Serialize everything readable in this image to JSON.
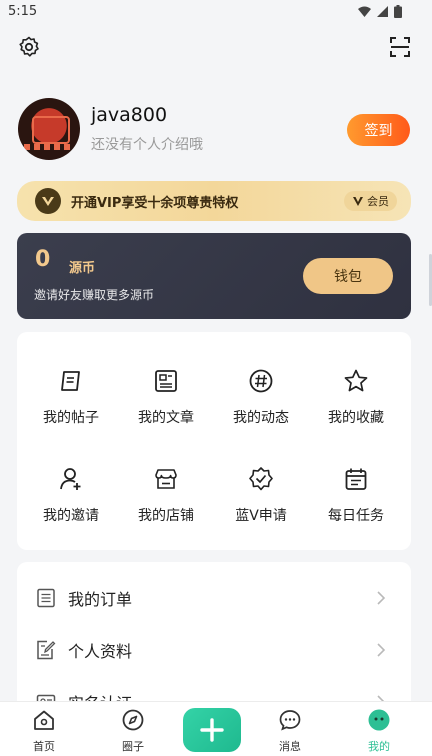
{
  "status_bar": {
    "time": "5:15"
  },
  "topbar": {
    "settings_icon": "gear-icon",
    "scan_icon": "scan-icon"
  },
  "profile": {
    "username": "java800",
    "bio": "还没有个人介绍哦",
    "signin_label": "签到"
  },
  "vip_banner": {
    "text": "开通VIP享受十余项尊贵特权",
    "badge_label": "会员"
  },
  "wallet": {
    "balance": "0",
    "unit": "源币",
    "invite_text": "邀请好友赚取更多源币",
    "button_label": "钱包"
  },
  "grid": [
    {
      "label": "我的帖子",
      "icon": "posts-icon"
    },
    {
      "label": "我的文章",
      "icon": "article-icon"
    },
    {
      "label": "我的动态",
      "icon": "hashtag-icon"
    },
    {
      "label": "我的收藏",
      "icon": "star-icon"
    },
    {
      "label": "我的邀请",
      "icon": "add-user-icon"
    },
    {
      "label": "我的店铺",
      "icon": "store-icon"
    },
    {
      "label": "蓝V申请",
      "icon": "verified-badge-icon"
    },
    {
      "label": "每日任务",
      "icon": "calendar-icon"
    }
  ],
  "list": [
    {
      "label": "我的订单",
      "icon": "order-icon"
    },
    {
      "label": "个人资料",
      "icon": "profile-edit-icon"
    },
    {
      "label": "实名认证",
      "icon": "id-card-icon"
    }
  ],
  "tabbar": {
    "tabs": [
      {
        "label": "首页",
        "icon": "home-icon"
      },
      {
        "label": "圈子",
        "icon": "compass-icon"
      },
      {
        "label": "消息",
        "icon": "message-icon"
      },
      {
        "label": "我的",
        "icon": "me-icon",
        "active": true
      }
    ],
    "post_button_icon": "plus-icon"
  },
  "colors": {
    "accent": "#2dbf94",
    "signin_gradient": [
      "#ff9a2e",
      "#ff5a1a"
    ],
    "wallet_bg": "#3b3e4d",
    "gold": "#f3c98d"
  }
}
